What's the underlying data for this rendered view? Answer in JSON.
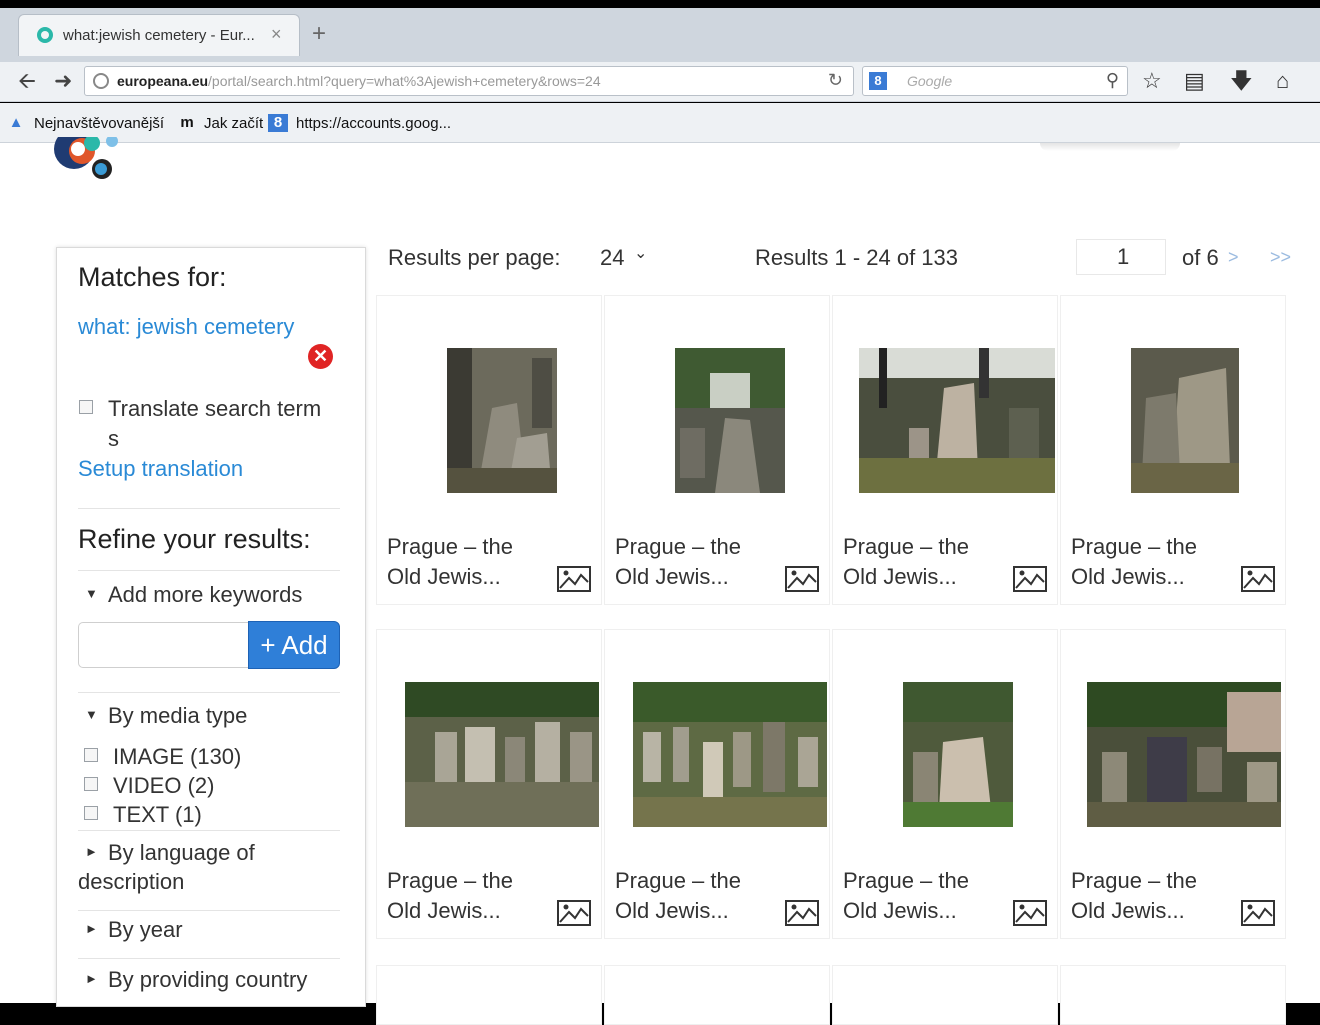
{
  "browser": {
    "tab_title": "what:jewish cemetery - Eur...",
    "tab_close": "×",
    "new_tab": "+",
    "url_host": "europeana.eu",
    "url_path": "/portal/search.html?query=what%3Ajewish+cemetery&rows=24",
    "search_placeholder": "Google",
    "bookmarks": [
      {
        "label": "Nejnavštěvovanější"
      },
      {
        "label": "Jak začít"
      },
      {
        "label": "https://accounts.goog..."
      }
    ]
  },
  "sidebar": {
    "matches_title": "Matches for:",
    "query_link": "what: jewish cemetery",
    "translate_label_1": "Translate search term",
    "translate_label_2": "s",
    "setup_translation": "Setup translation",
    "refine_title": "Refine your results:",
    "add_keywords": "Add more keywords",
    "add_button": "+ Add",
    "media_type_heading": "By media type",
    "media_types": [
      {
        "label": "IMAGE (130)"
      },
      {
        "label": "VIDEO (2)"
      },
      {
        "label": "TEXT (1)"
      }
    ],
    "language_heading_1": "By language of",
    "language_heading_2": "description",
    "year_heading": "By year",
    "country_heading": "By providing country"
  },
  "results_bar": {
    "per_page_label": "Results per page:",
    "per_page_value": "24",
    "count_text": "Results  1 - 24 of 133",
    "page_value": "1",
    "page_of": "of 6",
    "next": ">",
    "last": ">>"
  },
  "results": [
    {
      "line1": "Prague – the",
      "line2": "Old Jewis...",
      "media_icon": "image-icon"
    },
    {
      "line1": "Prague – the",
      "line2": "Old Jewis...",
      "media_icon": "image-icon"
    },
    {
      "line1": "Prague – the",
      "line2": "Old Jewis...",
      "media_icon": "image-icon"
    },
    {
      "line1": "Prague – the",
      "line2": "Old Jewis...",
      "media_icon": "image-icon"
    },
    {
      "line1": "Prague – the",
      "line2": "Old Jewis...",
      "media_icon": "image-icon"
    },
    {
      "line1": "Prague – the",
      "line2": "Old Jewis...",
      "media_icon": "image-icon"
    },
    {
      "line1": "Prague – the",
      "line2": "Old Jewis...",
      "media_icon": "image-icon"
    },
    {
      "line1": "Prague – the",
      "line2": "Old Jewis...",
      "media_icon": "image-icon"
    }
  ],
  "colors": {
    "link": "#2a8ad6",
    "add_button": "#2f7fd8",
    "remove": "#e02424"
  }
}
